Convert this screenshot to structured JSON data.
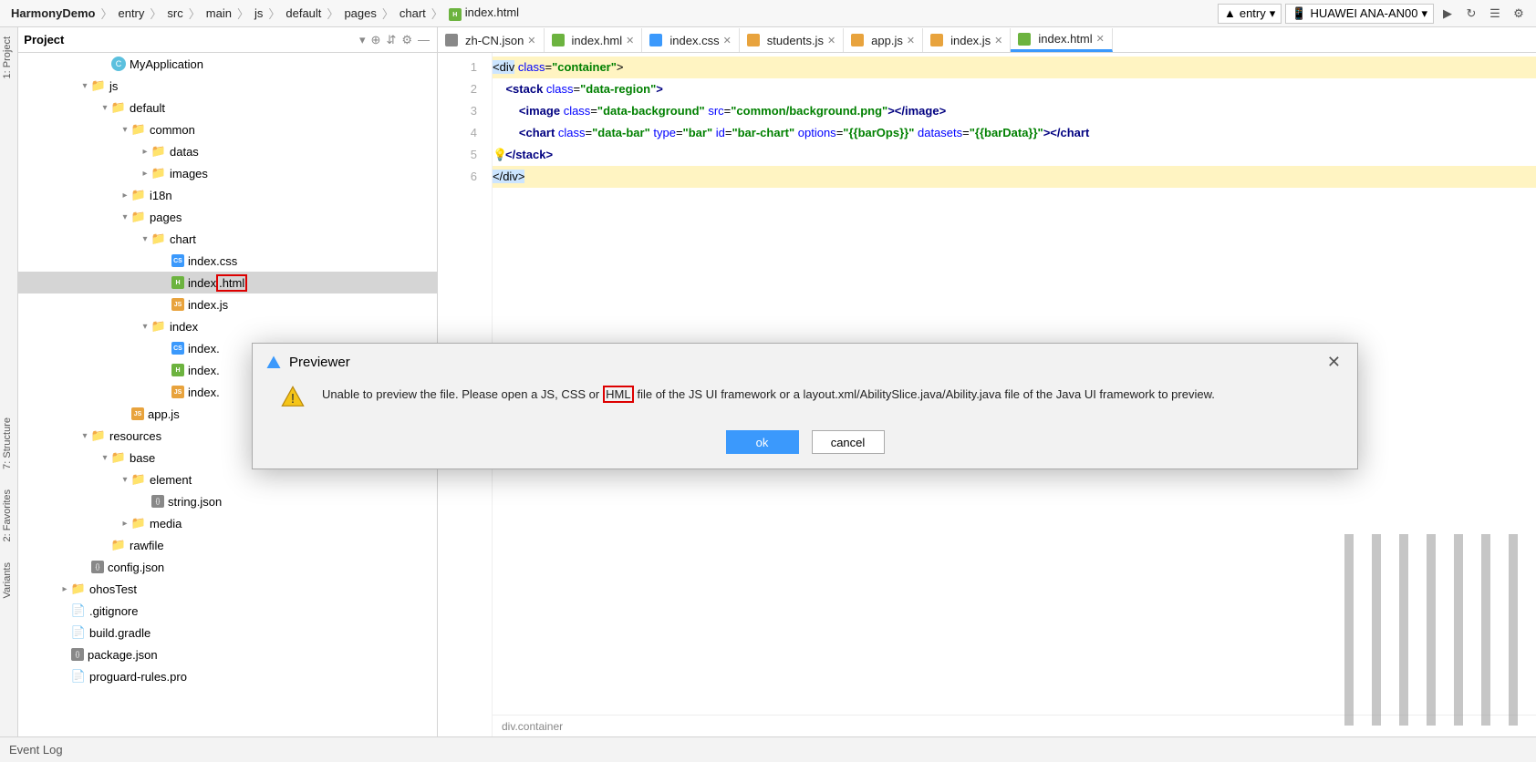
{
  "breadcrumbs": [
    "HarmonyDemo",
    "entry",
    "src",
    "main",
    "js",
    "default",
    "pages",
    "chart",
    "index.html"
  ],
  "topright": {
    "module": "entry",
    "device": "HUAWEI ANA-AN00"
  },
  "project_label": "Project",
  "tree": [
    {
      "d": 4,
      "t": "folder",
      "a": "",
      "l": "MyApplication",
      "ic": "C"
    },
    {
      "d": 3,
      "t": "folder",
      "a": "v",
      "l": "js"
    },
    {
      "d": 4,
      "t": "folder",
      "a": "v",
      "l": "default"
    },
    {
      "d": 5,
      "t": "folder",
      "a": "v",
      "l": "common"
    },
    {
      "d": 6,
      "t": "folder",
      "a": ">",
      "l": "datas"
    },
    {
      "d": 6,
      "t": "folder",
      "a": ">",
      "l": "images"
    },
    {
      "d": 5,
      "t": "folder",
      "a": ">",
      "l": "i18n"
    },
    {
      "d": 5,
      "t": "folder",
      "a": "v",
      "l": "pages"
    },
    {
      "d": 6,
      "t": "folder",
      "a": "v",
      "l": "chart"
    },
    {
      "d": 7,
      "t": "css",
      "a": "",
      "l": "index.css"
    },
    {
      "d": 7,
      "t": "html",
      "a": "",
      "l": "index.html",
      "sel": true,
      "redbox": ".html"
    },
    {
      "d": 7,
      "t": "js",
      "a": "",
      "l": "index.js"
    },
    {
      "d": 6,
      "t": "folder",
      "a": "v",
      "l": "index"
    },
    {
      "d": 7,
      "t": "css",
      "a": "",
      "l": "index."
    },
    {
      "d": 7,
      "t": "html",
      "a": "",
      "l": "index."
    },
    {
      "d": 7,
      "t": "js",
      "a": "",
      "l": "index."
    },
    {
      "d": 5,
      "t": "js",
      "a": "",
      "l": "app.js"
    },
    {
      "d": 3,
      "t": "folder",
      "a": "v",
      "l": "resources"
    },
    {
      "d": 4,
      "t": "folder",
      "a": "v",
      "l": "base"
    },
    {
      "d": 5,
      "t": "folder",
      "a": "v",
      "l": "element"
    },
    {
      "d": 6,
      "t": "json",
      "a": "",
      "l": "string.json"
    },
    {
      "d": 5,
      "t": "folder",
      "a": ">",
      "l": "media"
    },
    {
      "d": 4,
      "t": "folder",
      "a": "",
      "l": "rawfile"
    },
    {
      "d": 3,
      "t": "json",
      "a": "",
      "l": "config.json"
    },
    {
      "d": 2,
      "t": "folder",
      "a": ">",
      "l": "ohosTest"
    },
    {
      "d": 2,
      "t": "file",
      "a": "",
      "l": ".gitignore"
    },
    {
      "d": 2,
      "t": "file",
      "a": "",
      "l": "build.gradle"
    },
    {
      "d": 2,
      "t": "json",
      "a": "",
      "l": "package.json"
    },
    {
      "d": 2,
      "t": "file",
      "a": "",
      "l": "proguard-rules.pro"
    }
  ],
  "tabs": [
    {
      "l": "zh-CN.json",
      "ic": "json"
    },
    {
      "l": "index.hml",
      "ic": "html"
    },
    {
      "l": "index.css",
      "ic": "css"
    },
    {
      "l": "students.js",
      "ic": "js"
    },
    {
      "l": "app.js",
      "ic": "js"
    },
    {
      "l": "index.js",
      "ic": "js"
    },
    {
      "l": "index.html",
      "ic": "html",
      "active": true
    }
  ],
  "code_lines": [
    "1",
    "2",
    "3",
    "4",
    "5",
    "6"
  ],
  "code_tokens": [
    [
      {
        "c": "hl-b",
        "s": "<div"
      },
      {
        "c": "",
        "s": " "
      },
      {
        "c": "t-attr",
        "s": "class"
      },
      {
        "c": "",
        "s": "="
      },
      {
        "c": "t-str",
        "s": "\"container\""
      },
      {
        "c": "hl-y",
        "s": ">"
      }
    ],
    [
      {
        "c": "",
        "s": "    "
      },
      {
        "c": "t-tag",
        "s": "<stack "
      },
      {
        "c": "t-attr",
        "s": "class"
      },
      {
        "c": "",
        "s": "="
      },
      {
        "c": "t-str",
        "s": "\"data-region\""
      },
      {
        "c": "t-tag",
        "s": ">"
      }
    ],
    [
      {
        "c": "",
        "s": "        "
      },
      {
        "c": "t-tag",
        "s": "<image "
      },
      {
        "c": "t-attr",
        "s": "class"
      },
      {
        "c": "",
        "s": "="
      },
      {
        "c": "t-str",
        "s": "\"data-background\""
      },
      {
        "c": "",
        "s": " "
      },
      {
        "c": "t-attr",
        "s": "src"
      },
      {
        "c": "",
        "s": "="
      },
      {
        "c": "t-str",
        "s": "\"common/background.png\""
      },
      {
        "c": "t-tag",
        "s": "></image>"
      }
    ],
    [
      {
        "c": "",
        "s": "        "
      },
      {
        "c": "t-tag",
        "s": "<chart "
      },
      {
        "c": "t-attr",
        "s": "class"
      },
      {
        "c": "",
        "s": "="
      },
      {
        "c": "t-str",
        "s": "\"data-bar\""
      },
      {
        "c": "",
        "s": " "
      },
      {
        "c": "t-attr",
        "s": "type"
      },
      {
        "c": "",
        "s": "="
      },
      {
        "c": "t-str",
        "s": "\"bar\""
      },
      {
        "c": "",
        "s": " "
      },
      {
        "c": "t-attr",
        "s": "id"
      },
      {
        "c": "",
        "s": "="
      },
      {
        "c": "t-str",
        "s": "\"bar-chart\""
      },
      {
        "c": "",
        "s": " "
      },
      {
        "c": "t-attr",
        "s": "options"
      },
      {
        "c": "",
        "s": "="
      },
      {
        "c": "t-str",
        "s": "\"{{barOps}}\""
      },
      {
        "c": "",
        "s": " "
      },
      {
        "c": "t-attr",
        "s": "datasets"
      },
      {
        "c": "",
        "s": "="
      },
      {
        "c": "t-str",
        "s": "\"{{barData}}\""
      },
      {
        "c": "t-tag",
        "s": "></chart"
      }
    ],
    [
      {
        "c": "bulb",
        "s": "💡"
      },
      {
        "c": "t-tag",
        "s": "</stack>"
      }
    ],
    [
      {
        "c": "hl-b",
        "s": "</div>"
      }
    ]
  ],
  "editor_crumb": "div.container",
  "sidebar_labels": {
    "project": "1: Project",
    "structure": "7: Structure",
    "favorites": "2: Favorites",
    "variants": "Variants"
  },
  "status": {
    "event": "Event Log"
  },
  "dialog": {
    "title": "Previewer",
    "msg_pre": "Unable to preview the file. Please open a JS, CSS or",
    "msg_hl": "HML",
    "msg_post": "file of the JS UI framework or a layout.xml/AbilitySlice.java/Ability.java file of the Java UI framework to preview.",
    "ok": "ok",
    "cancel": "cancel"
  }
}
